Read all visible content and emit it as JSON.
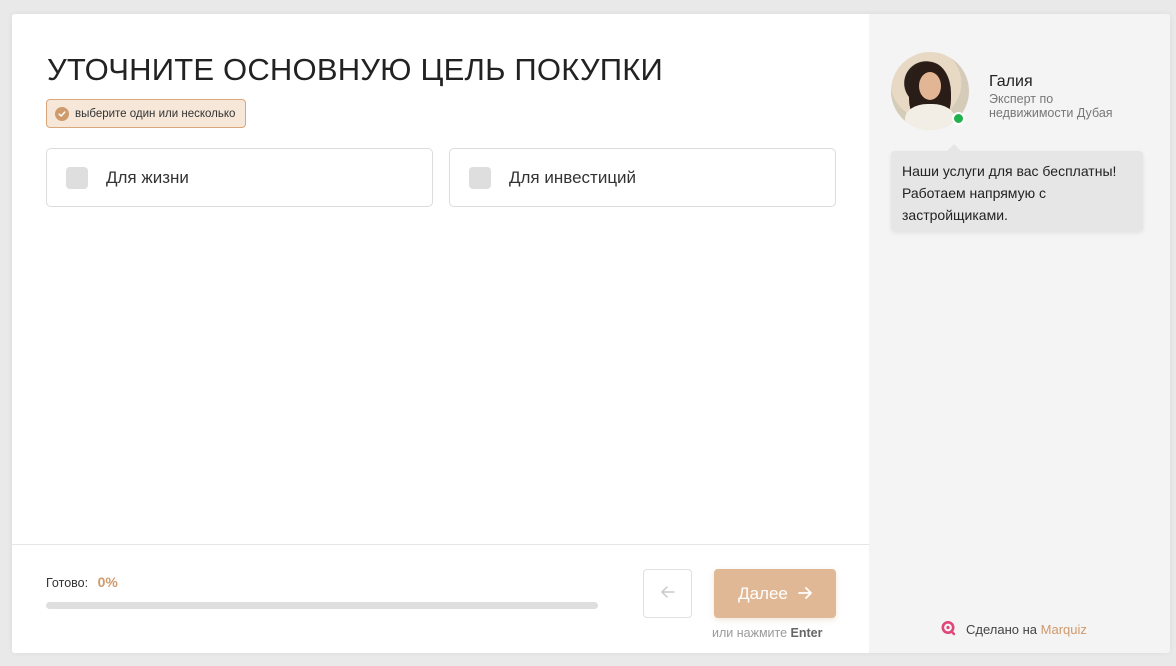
{
  "question": {
    "title": "УТОЧНИТЕ ОСНОВНУЮ ЦЕЛЬ ПОКУПКИ",
    "hint": "выберите один или несколько"
  },
  "options": [
    {
      "label": "Для жизни",
      "checked": false
    },
    {
      "label": "Для инвестиций",
      "checked": false
    }
  ],
  "progress": {
    "label": "Готово:",
    "value_text": "0%",
    "fraction": 0
  },
  "navigation": {
    "next_label": "Далее",
    "hint_prefix": "или нажмите",
    "hint_key": "Enter"
  },
  "expert": {
    "name": "Галия",
    "role": "Эксперт по недвижимости Дубая",
    "status": "online",
    "message": "Наши услуги для вас бесплатны! Работаем напрямую с застройщиками."
  },
  "branding": {
    "prefix": "Сделано на",
    "name": "Marquiz"
  },
  "colors": {
    "accent": "#cf9a6c",
    "next_button": "#e1b895",
    "online": "#22b14c",
    "sidebar_bg": "#f4f4f4"
  },
  "icons": {
    "hint": "check-circle-icon",
    "back": "arrow-left-icon",
    "next": "arrow-right-icon",
    "brand": "marquiz-logo-icon"
  }
}
